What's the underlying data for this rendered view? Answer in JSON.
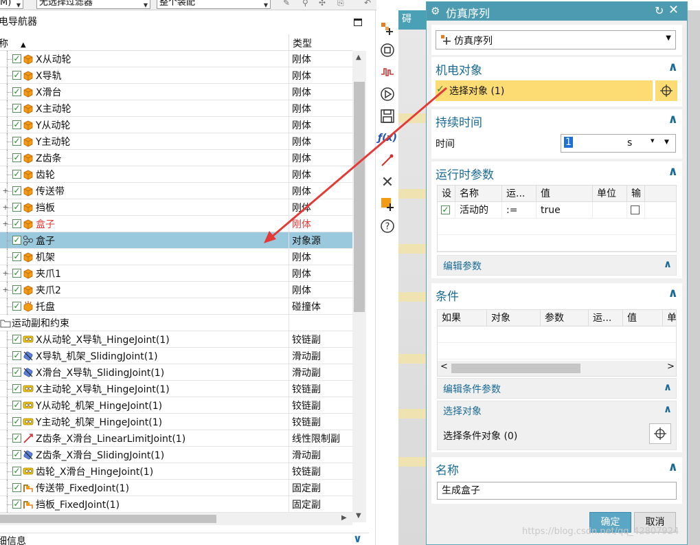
{
  "toolbar": {
    "combo0": "M)",
    "filter": "无选择过滤器",
    "assembly": "整个装配"
  },
  "navigator": {
    "title": "电导航器",
    "col_name": "称",
    "col_type": "类型",
    "rows": [
      {
        "name": "X从动轮",
        "type": "刚体",
        "icon": "rigid-body-icon",
        "expander": ""
      },
      {
        "name": "X导轨",
        "type": "刚体",
        "icon": "rigid-body-icon",
        "expander": ""
      },
      {
        "name": "X滑台",
        "type": "刚体",
        "icon": "rigid-body-icon",
        "expander": ""
      },
      {
        "name": "X主动轮",
        "type": "刚体",
        "icon": "rigid-body-icon",
        "expander": ""
      },
      {
        "name": "Y从动轮",
        "type": "刚体",
        "icon": "rigid-body-icon",
        "expander": ""
      },
      {
        "name": "Y主动轮",
        "type": "刚体",
        "icon": "rigid-body-icon",
        "expander": ""
      },
      {
        "name": "Z齿条",
        "type": "刚体",
        "icon": "rigid-body-icon",
        "expander": ""
      },
      {
        "name": "齿轮",
        "type": "刚体",
        "icon": "rigid-body-icon",
        "expander": ""
      },
      {
        "name": "传送带",
        "type": "刚体",
        "icon": "rigid-body-icon",
        "expander": "+"
      },
      {
        "name": "挡板",
        "type": "刚体",
        "icon": "rigid-body-icon",
        "expander": "+"
      },
      {
        "name": "盒子",
        "type": "刚体",
        "icon": "rigid-body-icon",
        "expander": "+",
        "red": true
      },
      {
        "name": "盒子",
        "type": "对象源",
        "icon": "object-source-icon",
        "expander": "",
        "selected": true
      },
      {
        "name": "机架",
        "type": "刚体",
        "icon": "rigid-body-icon",
        "expander": ""
      },
      {
        "name": "夹爪1",
        "type": "刚体",
        "icon": "rigid-body-icon",
        "expander": "+"
      },
      {
        "name": "夹爪2",
        "type": "刚体",
        "icon": "rigid-body-icon",
        "expander": "+"
      },
      {
        "name": "托盘",
        "type": "碰撞体",
        "icon": "collision-body-icon",
        "expander": ""
      },
      {
        "name": "运动副和约束",
        "type": "",
        "icon": "folder-icon",
        "expander": "",
        "group": true
      },
      {
        "name": "X从动轮_X导轨_HingeJoint(1)",
        "type": "铰链副",
        "icon": "hinge-joint-icon",
        "expander": ""
      },
      {
        "name": "X导轨_机架_SlidingJoint(1)",
        "type": "滑动副",
        "icon": "sliding-joint-icon",
        "expander": ""
      },
      {
        "name": "X滑台_X导轨_SlidingJoint(1)",
        "type": "滑动副",
        "icon": "sliding-joint-icon",
        "expander": ""
      },
      {
        "name": "X主动轮_X导轨_HingeJoint(1)",
        "type": "铰链副",
        "icon": "hinge-joint-icon",
        "expander": ""
      },
      {
        "name": "Y从动轮_机架_HingeJoint(1)",
        "type": "铰链副",
        "icon": "hinge-joint-icon",
        "expander": ""
      },
      {
        "name": "Y主动轮_机架_HingeJoint(1)",
        "type": "铰链副",
        "icon": "hinge-joint-icon",
        "expander": ""
      },
      {
        "name": "Z齿条_X滑台_LinearLimitJoint(1)",
        "type": "线性限制副",
        "icon": "linear-limit-joint-icon",
        "expander": ""
      },
      {
        "name": "Z齿条_X滑台_SlidingJoint(1)",
        "type": "滑动副",
        "icon": "sliding-joint-icon",
        "expander": ""
      },
      {
        "name": "齿轮_X滑台_HingeJoint(1)",
        "type": "铰链副",
        "icon": "hinge-joint-icon",
        "expander": ""
      },
      {
        "name": "传送带_FixedJoint(1)",
        "type": "固定副",
        "icon": "fixed-joint-icon",
        "expander": ""
      },
      {
        "name": "挡板_FixedJoint(1)",
        "type": "固定副",
        "icon": "fixed-joint-icon",
        "expander": ""
      }
    ],
    "details_title": "细信息"
  },
  "viewport": {
    "tab_label": "碍"
  },
  "dialog": {
    "title": "仿真序列",
    "type_combo": "仿真序列",
    "mech_object": {
      "title": "机电对象",
      "select_label": "选择对象 (1)"
    },
    "duration": {
      "title": "持续时间",
      "time_label": "时间",
      "time_value": "1",
      "unit": "s"
    },
    "runtime_params": {
      "title": "运行时参数",
      "columns": [
        "设",
        "名称",
        "运...",
        "值",
        "单位",
        "输"
      ],
      "rows": [
        {
          "name": "活动的",
          "op": ":=",
          "value": "true"
        }
      ],
      "edit_label": "编辑参数"
    },
    "condition": {
      "title": "条件",
      "columns": [
        "如果",
        "对象",
        "参数",
        "运...",
        "值",
        "单"
      ],
      "edit_label": "编辑条件参数",
      "select_header": "选择对象",
      "select_label": "选择条件对象 (0)"
    },
    "name": {
      "title": "名称",
      "value": "生成盒子"
    },
    "ok_label": "确定",
    "cancel_label": "取消"
  },
  "watermark": "https://blog.csdn.net/qq_42807924",
  "colors": {
    "accent": "#4d9bb0",
    "selected_row": "#9ac9de",
    "highlight": "#fddc73",
    "arrow": "#e53935"
  }
}
